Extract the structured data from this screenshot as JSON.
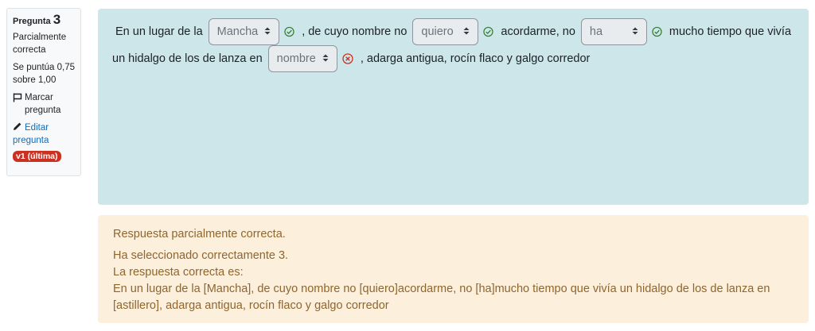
{
  "info": {
    "question_label": "Pregunta",
    "question_number": "3",
    "state": "Parcialmente correcta",
    "grade": "Se puntúa 0,75 sobre 1,00",
    "flag_label": "Marcar pregunta",
    "edit_label": "Editar pregunta",
    "version_badge": "v1 (última)"
  },
  "question": {
    "line1": {
      "t1": "En un lugar de la",
      "sel1": "Mancha",
      "t2": ", de cuyo nombre no",
      "sel2": "quiero",
      "t3": "acordarme, no",
      "sel3": "ha",
      "t4": "mucho tiempo que vivía"
    },
    "line2": {
      "t1": "un hidalgo de los de lanza en",
      "sel1": "nombre",
      "t2": ", adarga antigua, rocín flaco y galgo corredor"
    }
  },
  "feedback": {
    "summary": "Respuesta parcialmente correcta.",
    "selected": "Ha seleccionado correctamente 3.",
    "right_answer_label": "La respuesta correcta es:",
    "right_answer_line1": "En un lugar de la [Mancha], de cuyo nombre no [quiero]acordarme, no [ha]mucho tiempo que vivía un hidalgo de los de lanza en",
    "right_answer_line2": "[astillero], adarga antigua, rocín flaco y galgo corredor"
  },
  "colors": {
    "correct": "#357a32",
    "incorrect": "#ca3120",
    "formulation_bg": "#cce6ea",
    "feedback_bg": "#fcefdc",
    "feedback_text": "#8e662e",
    "link": "#0f6cbf"
  }
}
